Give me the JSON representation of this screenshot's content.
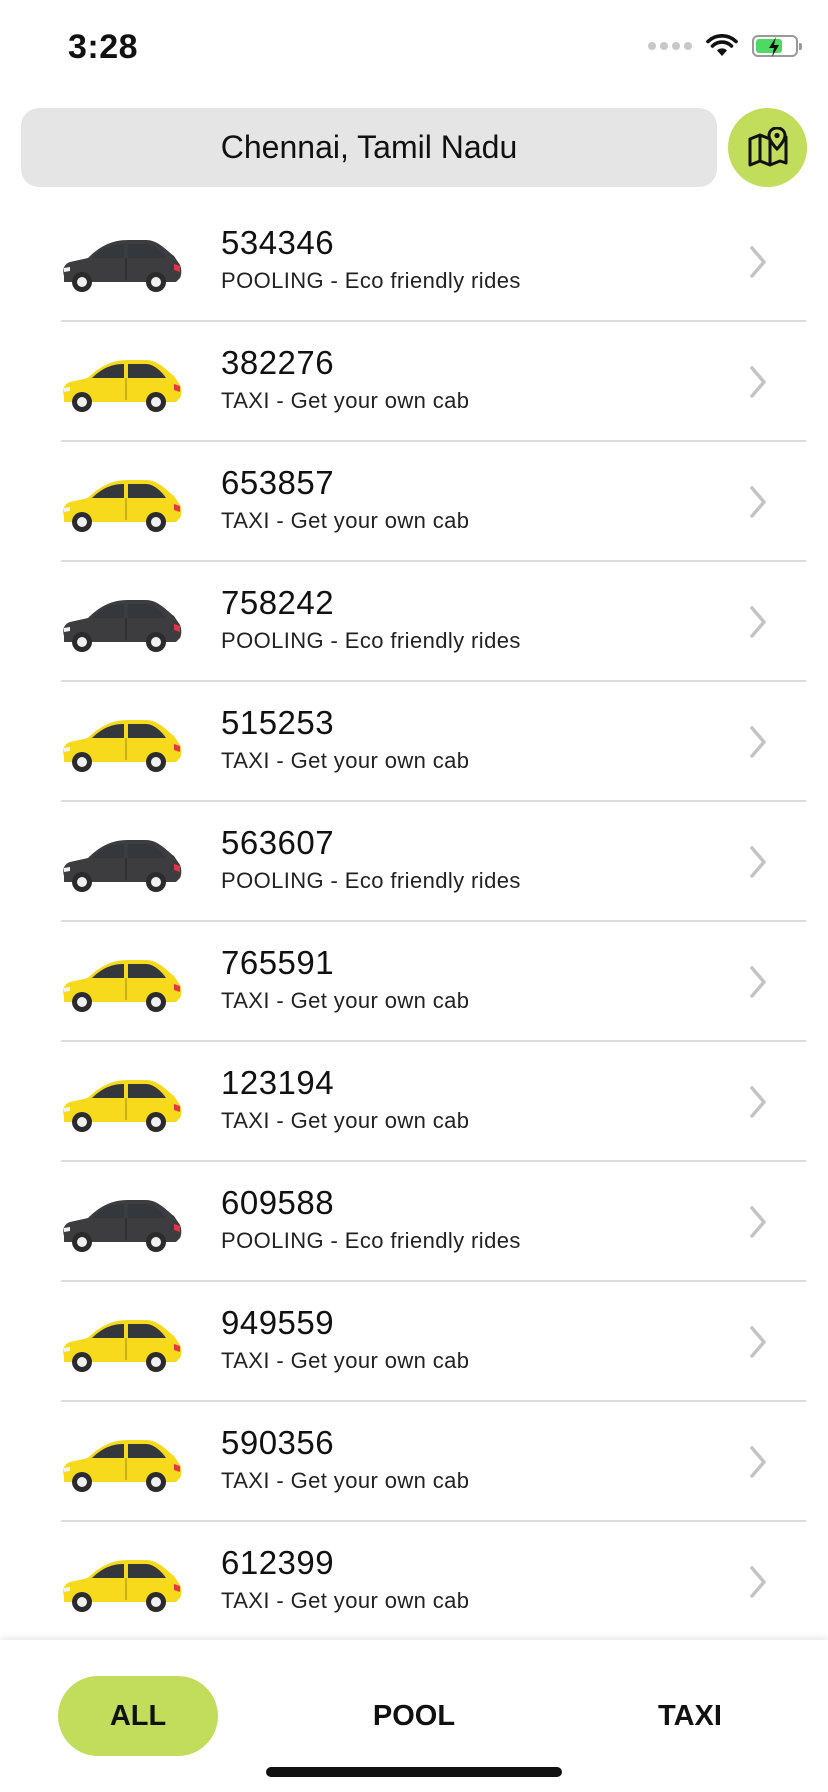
{
  "status_bar": {
    "time": "3:28",
    "icons": [
      "signal-icon",
      "wifi-icon",
      "battery-charging-icon"
    ]
  },
  "header": {
    "location": "Chennai, Tamil Nadu",
    "map_button_icon": "map-pin-icon"
  },
  "rides": [
    {
      "id": "534346",
      "type": "pooling",
      "description": "POOLING - Eco friendly rides"
    },
    {
      "id": "382276",
      "type": "taxi",
      "description": "TAXI - Get your own cab"
    },
    {
      "id": "653857",
      "type": "taxi",
      "description": "TAXI - Get your own cab"
    },
    {
      "id": "758242",
      "type": "pooling",
      "description": "POOLING - Eco friendly rides"
    },
    {
      "id": "515253",
      "type": "taxi",
      "description": "TAXI - Get your own cab"
    },
    {
      "id": "563607",
      "type": "pooling",
      "description": "POOLING - Eco friendly rides"
    },
    {
      "id": "765591",
      "type": "taxi",
      "description": "TAXI - Get your own cab"
    },
    {
      "id": "123194",
      "type": "taxi",
      "description": "TAXI - Get your own cab"
    },
    {
      "id": "609588",
      "type": "pooling",
      "description": "POOLING - Eco friendly rides"
    },
    {
      "id": "949559",
      "type": "taxi",
      "description": "TAXI - Get your own cab"
    },
    {
      "id": "590356",
      "type": "taxi",
      "description": "TAXI - Get your own cab"
    },
    {
      "id": "612399",
      "type": "taxi",
      "description": "TAXI - Get your own cab"
    }
  ],
  "tabs": {
    "all": "ALL",
    "pool": "POOL",
    "taxi": "TAXI",
    "active": "ALL"
  },
  "colors": {
    "accent": "#c2dc5b",
    "taxi_car": "#f7da1c",
    "pool_car": "#3d3d3f"
  }
}
